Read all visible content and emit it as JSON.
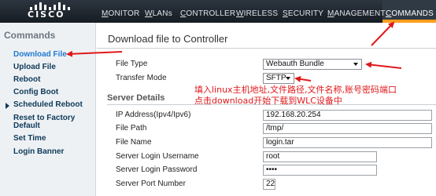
{
  "brand": {
    "name": "CISCO"
  },
  "nav": {
    "items": [
      {
        "label": "MONITOR",
        "underline": "M",
        "rest": "ONITOR"
      },
      {
        "label": "WLANs",
        "underline": "W",
        "rest": "LANs"
      },
      {
        "label": "CONTROLLER",
        "underline": "C",
        "rest": "ONTROLLER"
      },
      {
        "label": "WIRELESS",
        "underline": "W",
        "rest": "IRELESS"
      },
      {
        "label": "SECURITY",
        "underline": "S",
        "rest": "ECURITY"
      },
      {
        "label": "MANAGEMENT",
        "underline": "M",
        "rest": "ANAGEMENT"
      },
      {
        "label": "COMMANDS",
        "underline": "C",
        "rest": "OMMANDS"
      }
    ],
    "active": "COMMANDS"
  },
  "sidebar": {
    "title": "Commands",
    "items": [
      {
        "label": "Download File",
        "active": true
      },
      {
        "label": "Upload File"
      },
      {
        "label": "Reboot"
      },
      {
        "label": "Config Boot"
      },
      {
        "label": "Scheduled Reboot",
        "expandable": true
      },
      {
        "label": "Reset to Factory Default"
      },
      {
        "label": "Set Time"
      },
      {
        "label": "Login Banner"
      }
    ]
  },
  "main": {
    "title": "Download file to Controller",
    "file_type": {
      "label": "File Type",
      "value": "Webauth Bundle"
    },
    "transfer_mode": {
      "label": "Transfer Mode",
      "value": "SFTP"
    },
    "server_details": {
      "heading": "Server Details",
      "fields": [
        {
          "label": "IP Address(Ipv4/Ipv6)",
          "value": "192.168.20.254"
        },
        {
          "label": "File Path",
          "value": "/tmp/"
        },
        {
          "label": "File Name",
          "value": "login.tar"
        },
        {
          "label": "Server Login Username",
          "value": "root"
        },
        {
          "label": "Server Login Password",
          "value": "••••"
        },
        {
          "label": "Server Port Number",
          "value": "22"
        }
      ]
    }
  },
  "annotation": {
    "line1": "填入linux主机地址,文件路径,文件名称,账号密码端口",
    "line2": "点击download开始下载到WLC设备中",
    "color": "#e0181b"
  },
  "colors": {
    "active_tab_accent": "#ff9d1a",
    "nav_bg": "#1e262e",
    "link": "#0e3a5a"
  }
}
